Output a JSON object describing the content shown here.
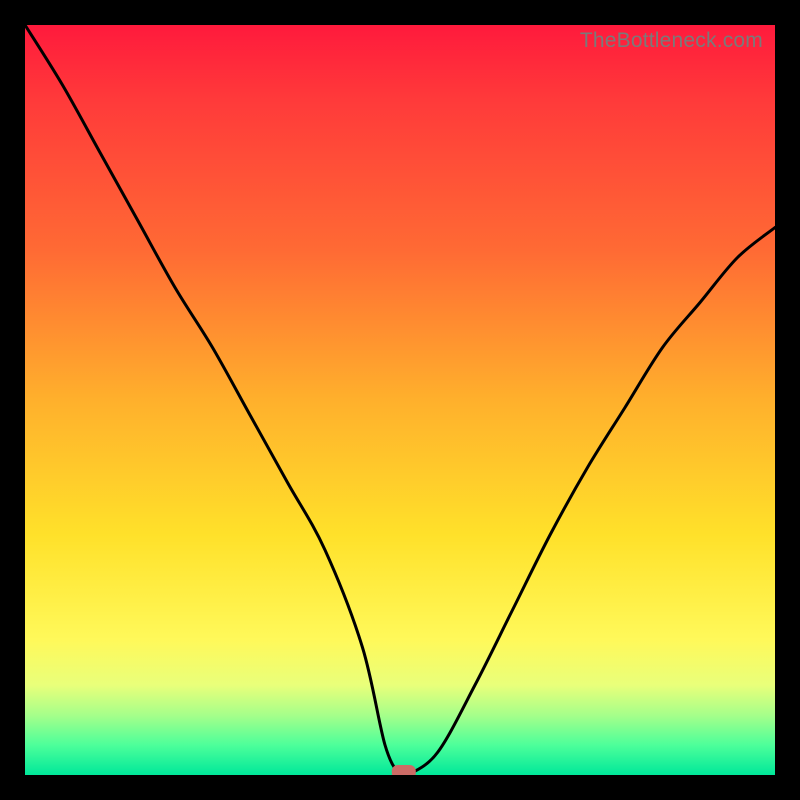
{
  "watermark": "TheBottleneck.com",
  "colors": {
    "gradient_top": "#ff1a3c",
    "gradient_mid1": "#ff8a2e",
    "gradient_mid2": "#ffe12a",
    "gradient_bottom": "#00e89a",
    "curve": "#000000",
    "marker": "#cc6b66",
    "frame": "#000000"
  },
  "chart_data": {
    "type": "line",
    "title": "",
    "xlabel": "",
    "ylabel": "",
    "xlim": [
      0,
      100
    ],
    "ylim": [
      0,
      100
    ],
    "series": [
      {
        "name": "bottleneck-curve",
        "x": [
          0,
          5,
          10,
          15,
          20,
          25,
          30,
          35,
          40,
          45,
          48,
          50,
          51,
          55,
          60,
          65,
          70,
          75,
          80,
          85,
          90,
          95,
          100
        ],
        "y": [
          100,
          92,
          83,
          74,
          65,
          57,
          48,
          39,
          30,
          17,
          4,
          0,
          0,
          3,
          12,
          22,
          32,
          41,
          49,
          57,
          63,
          69,
          73
        ]
      }
    ],
    "annotations": [
      {
        "name": "optimal-marker",
        "x": 50.5,
        "y": 0
      }
    ],
    "legend": false,
    "grid": false
  }
}
